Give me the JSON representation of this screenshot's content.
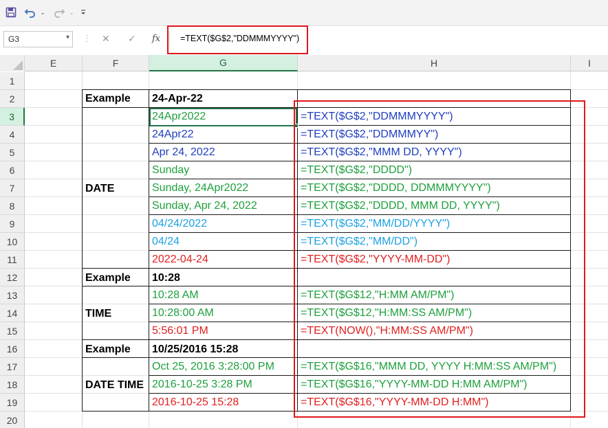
{
  "toolbar": {
    "save_icon": "save-icon",
    "undo_icon": "undo-icon",
    "redo_icon": "redo-icon",
    "customize_icon": "customize-qat-icon"
  },
  "formula_bar": {
    "name_box": "G3",
    "cancel_glyph": "✕",
    "enter_glyph": "✓",
    "fx_glyph": "fx",
    "formula": "=TEXT($G$2,\"DDMMMYYYY\")",
    "highlight_color": "#e0151b"
  },
  "columns": [
    "E",
    "F",
    "G",
    "H",
    "I"
  ],
  "selected_column": "G",
  "rows": [
    "1",
    "2",
    "3",
    "4",
    "5",
    "6",
    "7",
    "8",
    "9",
    "10",
    "11",
    "12",
    "13",
    "14",
    "15",
    "16",
    "17",
    "18",
    "19",
    "20"
  ],
  "selected_row": "3",
  "colors": {
    "green": "#1ea03c",
    "blue": "#1f3ebf",
    "cyan": "#1ba1e2",
    "red": "#e21e1e",
    "selection": "#217346"
  },
  "table": {
    "labels": {
      "r2": "Example",
      "date": "DATE",
      "r12": "Example",
      "time": "TIME",
      "r16": "Example",
      "datetime": "DATE TIME"
    },
    "examples": {
      "r2": "24-Apr-22",
      "r12": "10:28",
      "r16": "10/25/2016 15:28"
    },
    "results": [
      {
        "row": "3",
        "value": "24Apr2022",
        "formula": "=TEXT($G$2,\"DDMMMYYYY\")",
        "color": "green",
        "formula_color": "blue"
      },
      {
        "row": "4",
        "value": "24Apr22",
        "formula": "=TEXT($G$2,\"DDMMMYY\")",
        "color": "blue",
        "formula_color": "blue"
      },
      {
        "row": "5",
        "value": "Apr 24, 2022",
        "formula": "=TEXT($G$2,\"MMM DD, YYYY\")",
        "color": "blue",
        "formula_color": "blue"
      },
      {
        "row": "6",
        "value": "Sunday",
        "formula": "=TEXT($G$2,\"DDDD\")",
        "color": "green",
        "formula_color": "green"
      },
      {
        "row": "7",
        "value": "Sunday, 24Apr2022",
        "formula": "=TEXT($G$2,\"DDDD, DDMMMYYYY\")",
        "color": "green",
        "formula_color": "green"
      },
      {
        "row": "8",
        "value": "Sunday, Apr 24, 2022",
        "formula": "=TEXT($G$2,\"DDDD, MMM DD, YYYY\")",
        "color": "green",
        "formula_color": "green"
      },
      {
        "row": "9",
        "value": "04/24/2022",
        "formula": "=TEXT($G$2,\"MM/DD/YYYY\")",
        "color": "cyan",
        "formula_color": "cyan"
      },
      {
        "row": "10",
        "value": "04/24",
        "formula": "=TEXT($G$2,\"MM/DD\")",
        "color": "cyan",
        "formula_color": "cyan"
      },
      {
        "row": "11",
        "value": "2022-04-24",
        "formula": "=TEXT($G$2,\"YYYY-MM-DD\")",
        "color": "red",
        "formula_color": "red"
      },
      {
        "row": "13",
        "value": "10:28 AM",
        "formula": "=TEXT($G$12,\"H:MM AM/PM\")",
        "color": "green",
        "formula_color": "green"
      },
      {
        "row": "14",
        "value": "10:28:00 AM",
        "formula": "=TEXT($G$12,\"H:MM:SS AM/PM\")",
        "color": "green",
        "formula_color": "green"
      },
      {
        "row": "15",
        "value": "5:56:01 PM",
        "formula": "=TEXT(NOW(),\"H:MM:SS AM/PM\")",
        "color": "red",
        "formula_color": "red"
      },
      {
        "row": "17",
        "value": "Oct 25, 2016 3:28:00 PM",
        "formula": "=TEXT($G$16,\"MMM DD, YYYY H:MM:SS AM/PM\")",
        "color": "green",
        "formula_color": "green"
      },
      {
        "row": "18",
        "value": "2016-10-25 3:28 PM",
        "formula": "=TEXT($G$16,\"YYYY-MM-DD H:MM AM/PM\")",
        "color": "green",
        "formula_color": "green"
      },
      {
        "row": "19",
        "value": "2016-10-25 15:28",
        "formula": "=TEXT($G$16,\"YYYY-MM-DD H:MM\")",
        "color": "red",
        "formula_color": "red"
      }
    ]
  }
}
